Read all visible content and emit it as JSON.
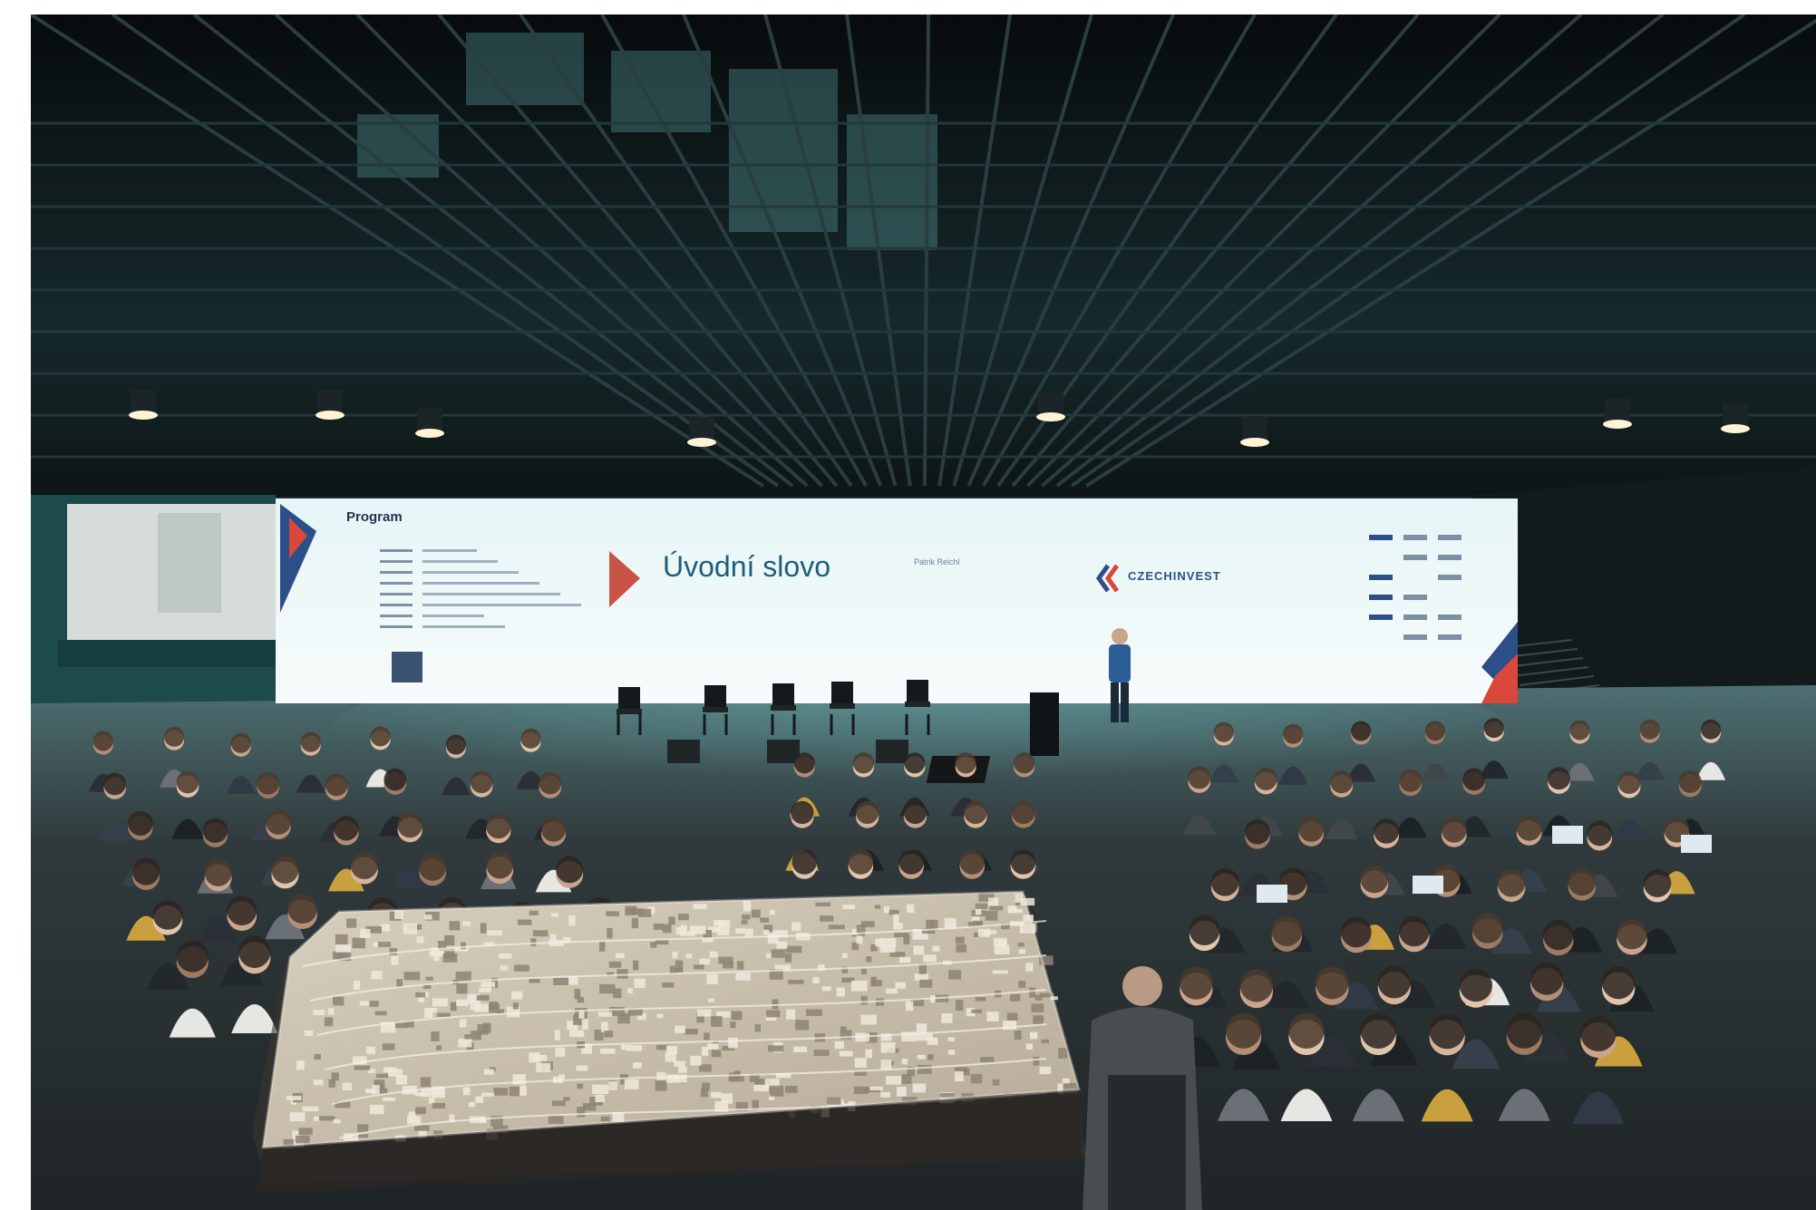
{
  "scene": {
    "description_tag": "conference-hall-photo"
  },
  "screen": {
    "program_title": "Program",
    "headline": "Úvodní slovo",
    "speaker_name": "Patrik Reichl",
    "brand_czech": "CZECH",
    "brand_invest": "INVEST"
  },
  "colors": {
    "screen_bg": "#eef7f8",
    "brand_blue": "#2c4f8a",
    "brand_red": "#d9483b",
    "ceiling": "#0e1416",
    "floor": "#2c3235",
    "teal_wall": "#1d4a4a",
    "headline": "#1f5d7a"
  }
}
